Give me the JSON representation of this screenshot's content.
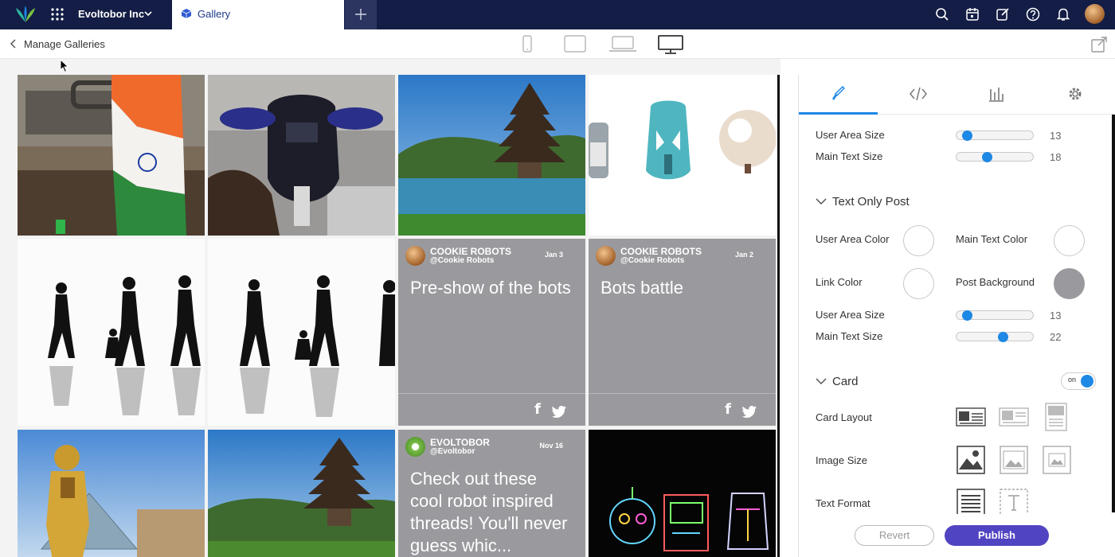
{
  "topbar": {
    "org_name": "Evoltobor Inc",
    "active_tab": "Gallery",
    "icons": [
      "logo-icon",
      "apps-grid-icon",
      "chevron-down-icon",
      "gallery-cube-icon",
      "plus-icon",
      "search-icon",
      "calendar-icon",
      "edit-icon",
      "help-icon",
      "bell-icon"
    ]
  },
  "subheader": {
    "back_label": "Manage Galleries",
    "devices": [
      "mobile-icon",
      "tablet-icon",
      "laptop-icon",
      "desktop-icon"
    ],
    "active_device": "desktop-icon"
  },
  "gallery": {
    "posts": [
      {
        "name": "COOKIE ROBOTS",
        "handle": "@Cookie Robots",
        "date": "Jan 3",
        "text": "Pre-show of the bots"
      },
      {
        "name": "COOKIE ROBOTS",
        "handle": "@Cookie Robots",
        "date": "Jan 2",
        "text": "Bots battle"
      },
      {
        "name": "EVOLTOBOR",
        "handle": "@Evoltobor",
        "date": "Nov 16",
        "text": "Check out these cool robot inspired threads! You'll never guess whic..."
      }
    ],
    "social": {
      "facebook": "f",
      "twitter": "twitter-icon"
    }
  },
  "panel": {
    "tabs": [
      "brush-icon",
      "code-icon",
      "analytics-icon",
      "settings-icon"
    ],
    "active_tab": "brush-icon",
    "top_sliders": [
      {
        "label": "User Area Size",
        "value": "13",
        "level": 0.14
      },
      {
        "label": "Main Text Size",
        "value": "18",
        "level": 0.4
      }
    ],
    "text_only_post": {
      "title": "Text Only Post",
      "colors": [
        {
          "label": "User Area Color",
          "color": "#ffffff"
        },
        {
          "label": "Main Text Color",
          "color": "#ffffff"
        },
        {
          "label": "Link Color",
          "color": "#ffffff"
        },
        {
          "label": "Post Background",
          "color": "#9a9a9e"
        }
      ],
      "sliders": [
        {
          "label": "User Area Size",
          "value": "13",
          "level": 0.14
        },
        {
          "label": "Main Text Size",
          "value": "22",
          "level": 0.6
        }
      ]
    },
    "card": {
      "title": "Card",
      "toggle": "on",
      "rows": [
        "Card Layout",
        "Image Size",
        "Text Format"
      ]
    },
    "actions": {
      "revert": "Revert",
      "publish": "Publish"
    }
  }
}
